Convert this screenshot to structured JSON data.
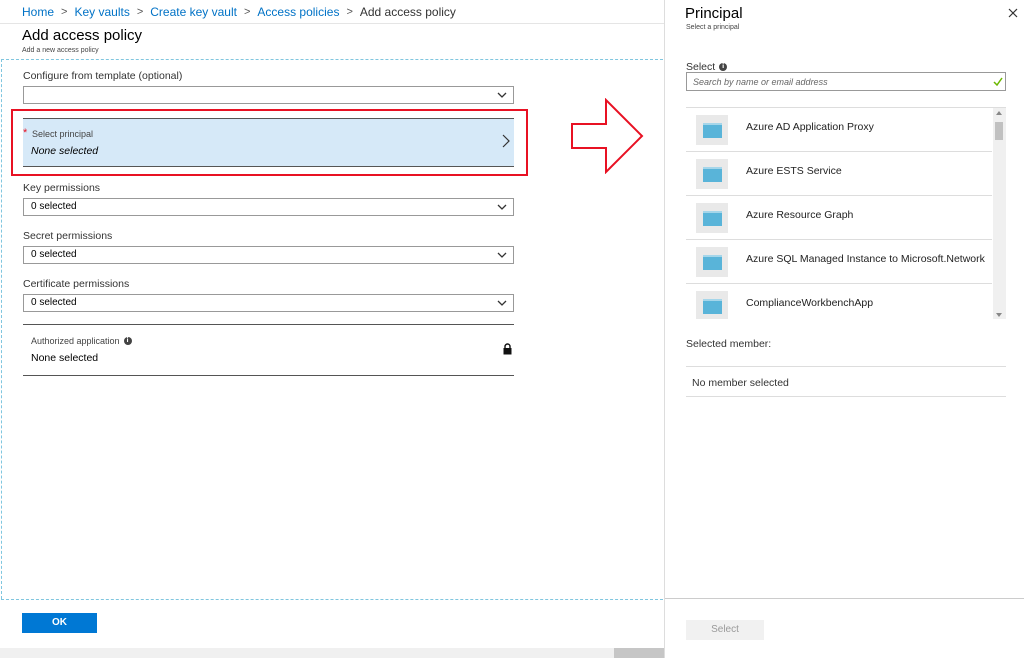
{
  "breadcrumb": {
    "items": [
      "Home",
      "Key vaults",
      "Create key vault",
      "Access policies"
    ],
    "current": "Add access policy"
  },
  "blade": {
    "title": "Add access policy",
    "subtitle": "Add a new access policy"
  },
  "form": {
    "template_label": "Configure from template (optional)",
    "template_value": "",
    "principal_required_mark": "*",
    "principal_label": "Select principal",
    "principal_value": "None selected",
    "key_permissions_label": "Key permissions",
    "key_permissions_value": "0 selected",
    "secret_permissions_label": "Secret permissions",
    "secret_permissions_value": "0 selected",
    "certificate_permissions_label": "Certificate permissions",
    "certificate_permissions_value": "0 selected",
    "authorized_app_label": "Authorized application",
    "authorized_app_value": "None selected",
    "ok_label": "OK"
  },
  "principal_panel": {
    "title": "Principal",
    "subtitle": "Select a principal",
    "select_label": "Select",
    "search_placeholder": "Search by name or email address",
    "items": [
      {
        "name": "Azure AD Application Proxy"
      },
      {
        "name": "Azure ESTS Service"
      },
      {
        "name": "Azure Resource Graph"
      },
      {
        "name": "Azure SQL Managed Instance to Microsoft.Network"
      },
      {
        "name": "ComplianceWorkbenchApp"
      }
    ],
    "selected_member_label": "Selected member:",
    "no_member_text": "No member selected",
    "select_button_label": "Select"
  },
  "colors": {
    "accent": "#0078d4",
    "link": "#0072c6",
    "highlight": "#e81123",
    "principal_bg": "#d6e9f8",
    "check": "#6bb700"
  },
  "icons": [
    "chevron-down-icon",
    "chevron-right-icon",
    "info-icon",
    "lock-icon",
    "close-icon",
    "checkmark-icon",
    "app-registration-icon",
    "right-arrow-annotation"
  ]
}
